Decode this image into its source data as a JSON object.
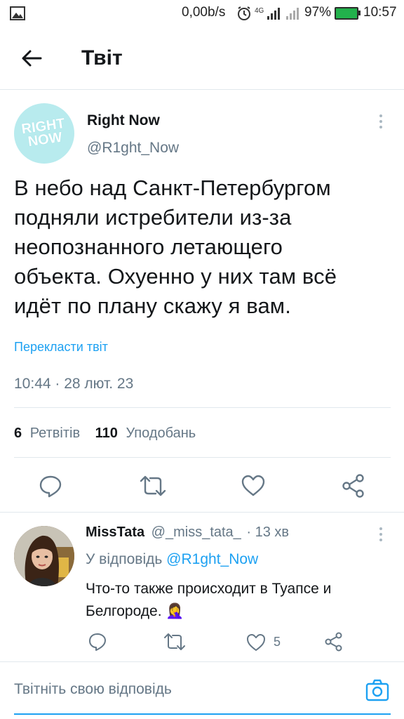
{
  "status_bar": {
    "speed": "0,00b/s",
    "network": "4G",
    "battery": "97%",
    "time": "10:57"
  },
  "header": {
    "title": "Твіт"
  },
  "tweet": {
    "author_name": "Right Now",
    "author_handle": "@R1ght_Now",
    "avatar_text_1": "RIGHT",
    "avatar_text_2": "NOW",
    "text_lines": [
      "В небо над Санкт-Петербургом",
      "подняли истребители из-за",
      "неопознанного летающего",
      "объекта. Охуенно у них там всё",
      "идёт по плану скажу я вам."
    ],
    "translate": "Перекласти твіт",
    "timestamp": "10:44 · 28 лют. 23",
    "retweets_count": "6",
    "retweets_label": "Ретвітів",
    "likes_count": "110",
    "likes_label": "Уподобань"
  },
  "reply": {
    "author_name": "MissTata",
    "author_handle": "@_miss_tata_",
    "time": "· 13 хв",
    "replying_prefix": "У відповідь",
    "replying_to": "@R1ght_Now",
    "text_lines": [
      "Что-то также происходит в Туапсе и",
      "Белгороде. 🤦‍♀"
    ],
    "likes_count": "5"
  },
  "composer": {
    "placeholder": "Твітніть свою відповідь"
  },
  "colors": {
    "accent": "#1da1f2",
    "muted": "#657786",
    "divider": "#e1e8ed",
    "battery": "#22b14c"
  }
}
